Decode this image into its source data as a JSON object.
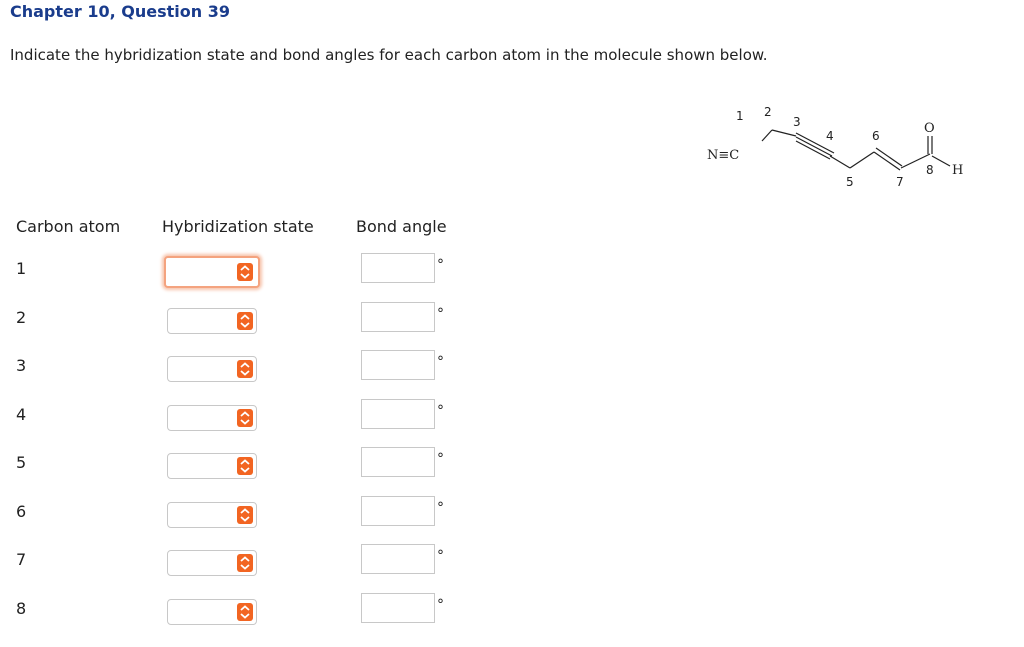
{
  "header": {
    "title": "Chapter 10, Question 39"
  },
  "instruction": "Indicate the hybridization state and bond angles for each carbon atom in the molecule shown below.",
  "molecule": {
    "labels": {
      "n_c": "N≡C",
      "o": "O",
      "h": "H"
    },
    "atom_numbers": [
      "1",
      "2",
      "3",
      "4",
      "5",
      "6",
      "7",
      "8"
    ]
  },
  "table": {
    "col_carbon": "Carbon atom",
    "col_hybridization": "Hybridization state",
    "col_angle": "Bond angle",
    "degree_symbol": "°",
    "rows": [
      {
        "atom": "1",
        "hybridization": "",
        "angle": ""
      },
      {
        "atom": "2",
        "hybridization": "",
        "angle": ""
      },
      {
        "atom": "3",
        "hybridization": "",
        "angle": ""
      },
      {
        "atom": "4",
        "hybridization": "",
        "angle": ""
      },
      {
        "atom": "5",
        "hybridization": "",
        "angle": ""
      },
      {
        "atom": "6",
        "hybridization": "",
        "angle": ""
      },
      {
        "atom": "7",
        "hybridization": "",
        "angle": ""
      },
      {
        "atom": "8",
        "hybridization": "",
        "angle": ""
      }
    ]
  },
  "colors": {
    "title": "#1a3c8c",
    "chevron_bg": "#f26522",
    "focus_ring": "#f4a37f"
  },
  "icons": {
    "select_chevron": "chevron-up-down-icon"
  }
}
